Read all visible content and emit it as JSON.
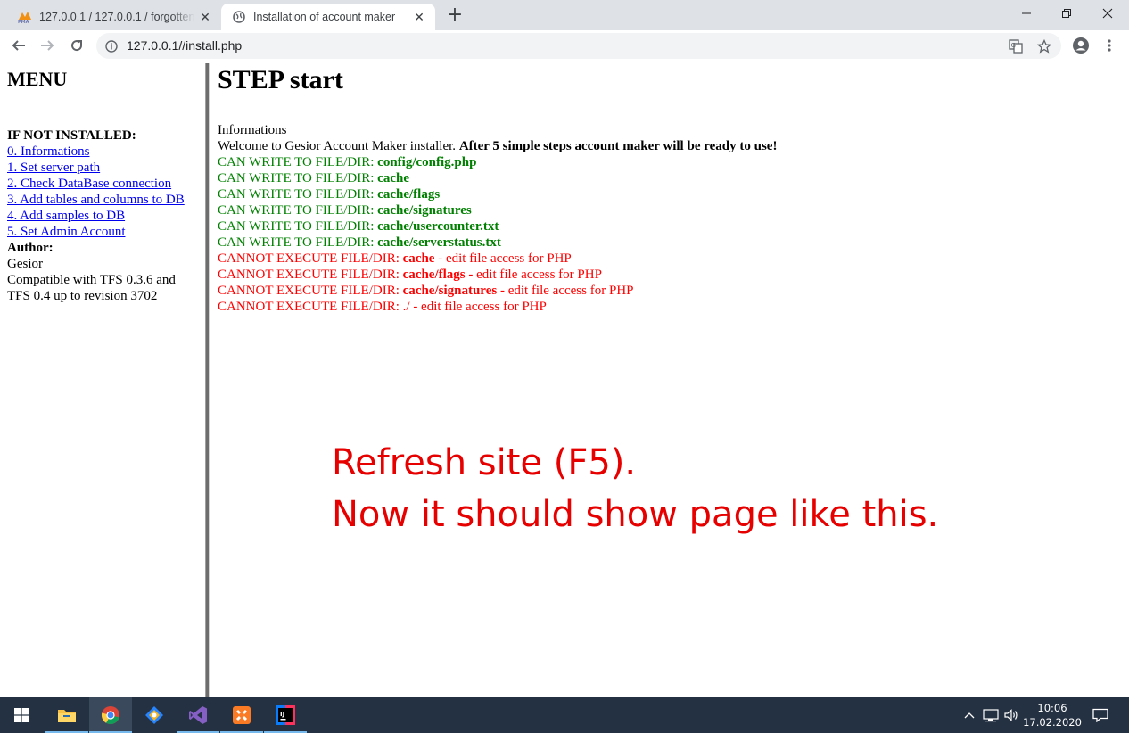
{
  "browser": {
    "tabs": [
      {
        "title": "127.0.0.1 / 127.0.0.1 / forgottenserver",
        "favicon": "phpmyadmin-icon",
        "active": false
      },
      {
        "title": "Installation of account maker",
        "favicon": "globe-icon",
        "active": true
      }
    ],
    "url": "127.0.0.1//install.php"
  },
  "menu": {
    "heading": "MENU",
    "install_label": "IF NOT INSTALLED:",
    "links": [
      "0. Informations",
      "1. Set server path",
      "2. Check DataBase connection",
      "3. Add tables and columns to DB",
      "4. Add samples to DB",
      "5. Set Admin Account"
    ],
    "author_label": "Author:",
    "author_name": "Gesior",
    "compat_line1": "Compatible with TFS 0.3.6 and",
    "compat_line2": "TFS 0.4 up to revision 3702"
  },
  "main": {
    "heading": "STEP start",
    "info_title": "Informations",
    "welcome_text": "Welcome to Gesior Account Maker installer. ",
    "welcome_bold": "After 5 simple steps account maker will be ready to use!",
    "can_write_prefix": "CAN WRITE TO FILE/DIR: ",
    "can_write": [
      "config/config.php",
      "cache",
      "cache/flags",
      "cache/signatures",
      "cache/usercounter.txt",
      "cache/serverstatus.txt"
    ],
    "cannot_exec_prefix": "CANNOT EXECUTE FILE/DIR: ",
    "cannot_exec_suffix": " - edit file access for PHP",
    "cannot_exec_bold": [
      "cache",
      "cache/flags",
      "cache/signatures"
    ],
    "cannot_exec_plain": "./",
    "colors": {
      "ok": "#008000",
      "error": "#ff0000",
      "link": "#0000ee"
    }
  },
  "annotation": {
    "line1": "Refresh site (F5).",
    "line2": "Now it should show page like this.",
    "color": "#e60000"
  },
  "taskbar": {
    "apps": [
      "windows-start-icon",
      "file-explorer-icon",
      "chrome-icon",
      "sourcetree-icon",
      "visual-studio-icon",
      "xampp-icon",
      "intellij-icon"
    ],
    "time": "10:06",
    "date": "17.02.2020"
  }
}
